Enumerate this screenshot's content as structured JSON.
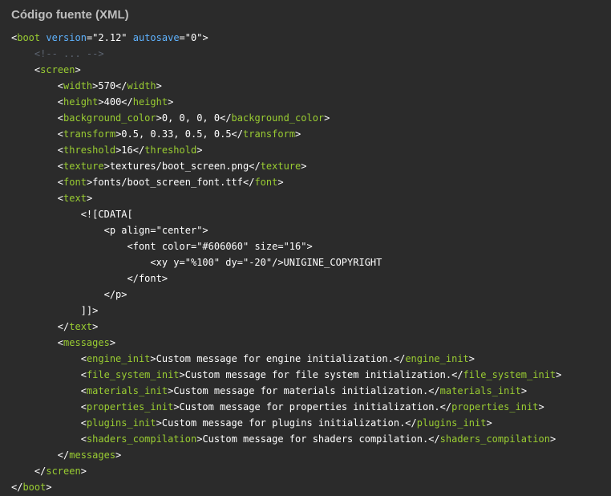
{
  "header": {
    "title": "Código fuente (XML)"
  },
  "code": {
    "lines": [
      {
        "indent": 0,
        "segments": [
          {
            "t": "<",
            "c": "txt"
          },
          {
            "t": "boot",
            "c": "tag"
          },
          {
            "t": " ",
            "c": "txt"
          },
          {
            "t": "version",
            "c": "attr"
          },
          {
            "t": "=\"2.12\" ",
            "c": "txt"
          },
          {
            "t": "autosave",
            "c": "attr"
          },
          {
            "t": "=\"0\">",
            "c": "txt"
          }
        ]
      },
      {
        "indent": 1,
        "segments": [
          {
            "t": "<!-- ... -->",
            "c": "comment"
          }
        ]
      },
      {
        "indent": 1,
        "segments": [
          {
            "t": "<",
            "c": "txt"
          },
          {
            "t": "screen",
            "c": "tag"
          },
          {
            "t": ">",
            "c": "txt"
          }
        ]
      },
      {
        "indent": 2,
        "segments": [
          {
            "t": "<",
            "c": "txt"
          },
          {
            "t": "width",
            "c": "tag"
          },
          {
            "t": ">570</",
            "c": "txt"
          },
          {
            "t": "width",
            "c": "tag"
          },
          {
            "t": ">",
            "c": "txt"
          }
        ]
      },
      {
        "indent": 2,
        "segments": [
          {
            "t": "<",
            "c": "txt"
          },
          {
            "t": "height",
            "c": "tag"
          },
          {
            "t": ">400</",
            "c": "txt"
          },
          {
            "t": "height",
            "c": "tag"
          },
          {
            "t": ">",
            "c": "txt"
          }
        ]
      },
      {
        "indent": 2,
        "segments": [
          {
            "t": "<",
            "c": "txt"
          },
          {
            "t": "background_color",
            "c": "tag"
          },
          {
            "t": ">0, 0, 0, 0</",
            "c": "txt"
          },
          {
            "t": "background_color",
            "c": "tag"
          },
          {
            "t": ">",
            "c": "txt"
          }
        ]
      },
      {
        "indent": 2,
        "segments": [
          {
            "t": "<",
            "c": "txt"
          },
          {
            "t": "transform",
            "c": "tag"
          },
          {
            "t": ">0.5, 0.33, 0.5, 0.5</",
            "c": "txt"
          },
          {
            "t": "transform",
            "c": "tag"
          },
          {
            "t": ">",
            "c": "txt"
          }
        ]
      },
      {
        "indent": 2,
        "segments": [
          {
            "t": "<",
            "c": "txt"
          },
          {
            "t": "threshold",
            "c": "tag"
          },
          {
            "t": ">16</",
            "c": "txt"
          },
          {
            "t": "threshold",
            "c": "tag"
          },
          {
            "t": ">",
            "c": "txt"
          }
        ]
      },
      {
        "indent": 2,
        "segments": [
          {
            "t": "<",
            "c": "txt"
          },
          {
            "t": "texture",
            "c": "tag"
          },
          {
            "t": ">textures/boot_screen.png</",
            "c": "txt"
          },
          {
            "t": "texture",
            "c": "tag"
          },
          {
            "t": ">",
            "c": "txt"
          }
        ]
      },
      {
        "indent": 2,
        "segments": [
          {
            "t": "<",
            "c": "txt"
          },
          {
            "t": "font",
            "c": "tag"
          },
          {
            "t": ">fonts/boot_screen_font.ttf</",
            "c": "txt"
          },
          {
            "t": "font",
            "c": "tag"
          },
          {
            "t": ">",
            "c": "txt"
          }
        ]
      },
      {
        "indent": 2,
        "segments": [
          {
            "t": "<",
            "c": "txt"
          },
          {
            "t": "text",
            "c": "tag"
          },
          {
            "t": ">",
            "c": "txt"
          }
        ]
      },
      {
        "indent": 3,
        "segments": [
          {
            "t": "<![CDATA[",
            "c": "txt"
          }
        ]
      },
      {
        "indent": 4,
        "segments": [
          {
            "t": "<p align=\"center\">",
            "c": "txt"
          }
        ]
      },
      {
        "indent": 5,
        "segments": [
          {
            "t": "<font color=\"#606060\" size=\"16\">",
            "c": "txt"
          }
        ]
      },
      {
        "indent": 6,
        "segments": [
          {
            "t": "<xy y=\"%100\" dy=\"-20\"/>UNIGINE_COPYRIGHT",
            "c": "txt"
          }
        ]
      },
      {
        "indent": 5,
        "segments": [
          {
            "t": "</font>",
            "c": "txt"
          }
        ]
      },
      {
        "indent": 4,
        "segments": [
          {
            "t": "</p>",
            "c": "txt"
          }
        ]
      },
      {
        "indent": 3,
        "segments": [
          {
            "t": "]]>",
            "c": "txt"
          }
        ]
      },
      {
        "indent": 2,
        "segments": [
          {
            "t": "</",
            "c": "txt"
          },
          {
            "t": "text",
            "c": "tag"
          },
          {
            "t": ">",
            "c": "txt"
          }
        ]
      },
      {
        "indent": 2,
        "segments": [
          {
            "t": "<",
            "c": "txt"
          },
          {
            "t": "messages",
            "c": "tag"
          },
          {
            "t": ">",
            "c": "txt"
          }
        ]
      },
      {
        "indent": 3,
        "segments": [
          {
            "t": "<",
            "c": "txt"
          },
          {
            "t": "engine_init",
            "c": "tag"
          },
          {
            "t": ">Custom message for engine initialization.</",
            "c": "txt"
          },
          {
            "t": "engine_init",
            "c": "tag"
          },
          {
            "t": ">",
            "c": "txt"
          }
        ]
      },
      {
        "indent": 3,
        "segments": [
          {
            "t": "<",
            "c": "txt"
          },
          {
            "t": "file_system_init",
            "c": "tag"
          },
          {
            "t": ">Custom message for file system initialization.</",
            "c": "txt"
          },
          {
            "t": "file_system_init",
            "c": "tag"
          },
          {
            "t": ">",
            "c": "txt"
          }
        ]
      },
      {
        "indent": 3,
        "segments": [
          {
            "t": "<",
            "c": "txt"
          },
          {
            "t": "materials_init",
            "c": "tag"
          },
          {
            "t": ">Custom message for materials initialization.</",
            "c": "txt"
          },
          {
            "t": "materials_init",
            "c": "tag"
          },
          {
            "t": ">",
            "c": "txt"
          }
        ]
      },
      {
        "indent": 3,
        "segments": [
          {
            "t": "<",
            "c": "txt"
          },
          {
            "t": "properties_init",
            "c": "tag"
          },
          {
            "t": ">Custom message for properties initialization.</",
            "c": "txt"
          },
          {
            "t": "properties_init",
            "c": "tag"
          },
          {
            "t": ">",
            "c": "txt"
          }
        ]
      },
      {
        "indent": 3,
        "segments": [
          {
            "t": "<",
            "c": "txt"
          },
          {
            "t": "plugins_init",
            "c": "tag"
          },
          {
            "t": ">Custom message for plugins initialization.</",
            "c": "txt"
          },
          {
            "t": "plugins_init",
            "c": "tag"
          },
          {
            "t": ">",
            "c": "txt"
          }
        ]
      },
      {
        "indent": 3,
        "segments": [
          {
            "t": "<",
            "c": "txt"
          },
          {
            "t": "shaders_compilation",
            "c": "tag"
          },
          {
            "t": ">Custom message for shaders compilation.</",
            "c": "txt"
          },
          {
            "t": "shaders_compilation",
            "c": "tag"
          },
          {
            "t": ">",
            "c": "txt"
          }
        ]
      },
      {
        "indent": 2,
        "segments": [
          {
            "t": "</",
            "c": "txt"
          },
          {
            "t": "messages",
            "c": "tag"
          },
          {
            "t": ">",
            "c": "txt"
          }
        ]
      },
      {
        "indent": 1,
        "segments": [
          {
            "t": "</",
            "c": "txt"
          },
          {
            "t": "screen",
            "c": "tag"
          },
          {
            "t": ">",
            "c": "txt"
          }
        ]
      },
      {
        "indent": 0,
        "segments": [
          {
            "t": "</",
            "c": "txt"
          },
          {
            "t": "boot",
            "c": "tag"
          },
          {
            "t": ">",
            "c": "txt"
          }
        ]
      }
    ]
  }
}
